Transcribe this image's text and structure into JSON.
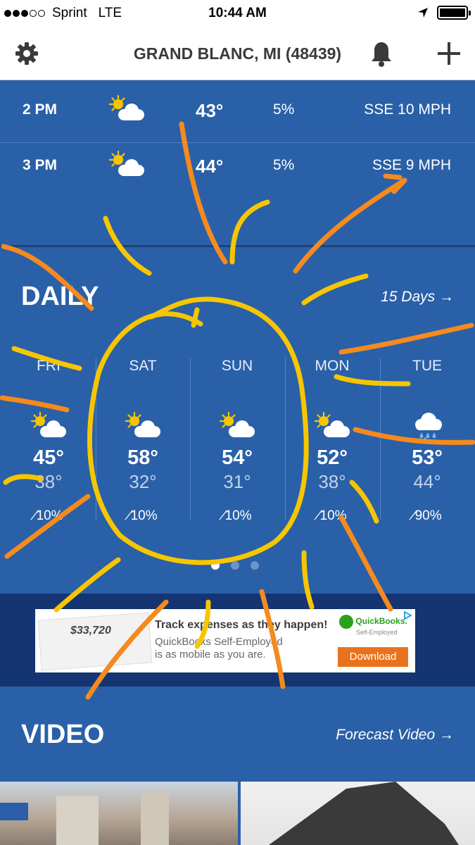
{
  "status_bar": {
    "carrier": "Sprint",
    "network": "LTE",
    "time": "10:44 AM"
  },
  "header": {
    "location": "GRAND BLANC, MI (48439)"
  },
  "hourly": [
    {
      "time": "2 PM",
      "icon": "partly-sunny-icon",
      "temp": "43°",
      "precip": "5%",
      "wind": "SSE 10 MPH"
    },
    {
      "time": "3 PM",
      "icon": "partly-sunny-icon",
      "temp": "44°",
      "precip": "5%",
      "wind": "SSE 9 MPH"
    }
  ],
  "daily": {
    "title": "DAILY",
    "link": "15 Days",
    "days": [
      {
        "name": "FRI",
        "icon": "partly-sunny-icon",
        "high": "45°",
        "low": "38°",
        "precip": "10%"
      },
      {
        "name": "SAT",
        "icon": "partly-sunny-icon",
        "high": "58°",
        "low": "32°",
        "precip": "10%"
      },
      {
        "name": "SUN",
        "icon": "partly-sunny-icon",
        "high": "54°",
        "low": "31°",
        "precip": "10%"
      },
      {
        "name": "MON",
        "icon": "partly-sunny-icon",
        "high": "52°",
        "low": "38°",
        "precip": "10%"
      },
      {
        "name": "TUE",
        "icon": "rain-cloud-icon",
        "high": "53°",
        "low": "44°",
        "precip": "90%"
      }
    ],
    "pager": {
      "pages": 3,
      "current": 1
    }
  },
  "ad": {
    "amount": "$33,720",
    "headline": "Track expenses as they happen!",
    "line2": "QuickBooks Self-Employed",
    "line3": "is as mobile as you are.",
    "brand": "QuickBooks.",
    "brand_sub": "Self-Employed",
    "button": "Download"
  },
  "video": {
    "title": "VIDEO",
    "link": "Forecast Video"
  },
  "colors": {
    "background": "#2a60a8",
    "ad_band": "#143472",
    "sun_doodle": "#f7c600",
    "ray_doodle": "#f58a1f",
    "cta": "#e8731c"
  }
}
